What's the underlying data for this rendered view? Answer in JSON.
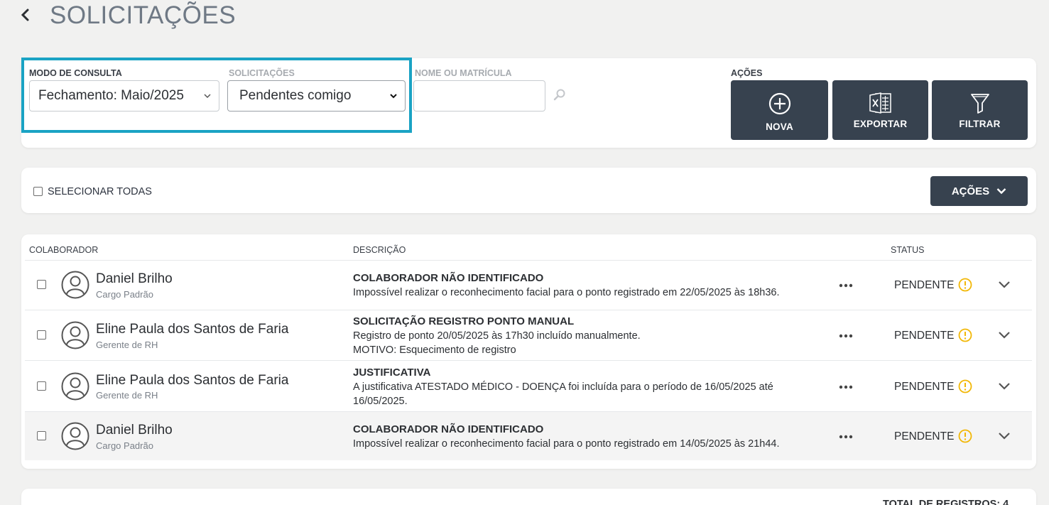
{
  "header": {
    "title": "SOLICITAÇÕES"
  },
  "filters": {
    "mode_label": "MODO DE CONSULTA",
    "mode_value": "Fechamento: Maio/2025",
    "requests_label": "SOLICITAÇÕES",
    "requests_value": "Pendentes comigo",
    "name_label": "NOME OU MATRÍCULA",
    "name_value": "",
    "actions_label": "AÇÕES"
  },
  "actions": {
    "new": "NOVA",
    "export": "EXPORTAR",
    "filter": "FILTRAR"
  },
  "selection": {
    "select_all": "SELECIONAR TODAS",
    "actions_dropdown": "AÇÕES"
  },
  "table": {
    "headers": {
      "employee": "COLABORADOR",
      "description": "DESCRIÇÃO",
      "status": "STATUS"
    },
    "rows": [
      {
        "name": "Daniel Brilho",
        "role": "Cargo Padrão",
        "title": "COLABORADOR NÃO IDENTIFICADO",
        "lines": [
          "Impossível realizar o reconhecimento facial para o ponto registrado em 22/05/2025 às 18h36."
        ],
        "status": "PENDENTE"
      },
      {
        "name": "Eline Paula dos Santos de Faria",
        "role": "Gerente de RH",
        "title": "SOLICITAÇÃO REGISTRO PONTO MANUAL",
        "lines": [
          "Registro de ponto 20/05/2025 às 17h30 incluído manualmente.",
          "MOTIVO: Esquecimento de registro"
        ],
        "status": "PENDENTE"
      },
      {
        "name": "Eline Paula dos Santos de Faria",
        "role": "Gerente de RH",
        "title": "JUSTIFICATIVA",
        "lines": [
          "A justificativa ATESTADO MÉDICO - DOENÇA foi incluída para o período de 16/05/2025 até 16/05/2025."
        ],
        "status": "PENDENTE"
      },
      {
        "name": "Daniel Brilho",
        "role": "Cargo Padrão",
        "title": "COLABORADOR NÃO IDENTIFICADO",
        "lines": [
          "Impossível realizar o reconhecimento facial para o ponto registrado em 14/05/2025 às 21h44."
        ],
        "status": "PENDENTE"
      }
    ]
  },
  "footer": {
    "total": "TOTAL DE REGISTROS: 4"
  },
  "colors": {
    "accent": "#1aa3c4",
    "button_dark": "#37424f",
    "warning": "#f2b705",
    "title": "#6f7985"
  },
  "icons": [
    "chevron-left-icon",
    "chevron-down-icon",
    "search-icon",
    "plus-circle-icon",
    "excel-icon",
    "funnel-icon",
    "user-avatar-icon",
    "more-horizontal-icon",
    "warning-circle-icon"
  ]
}
